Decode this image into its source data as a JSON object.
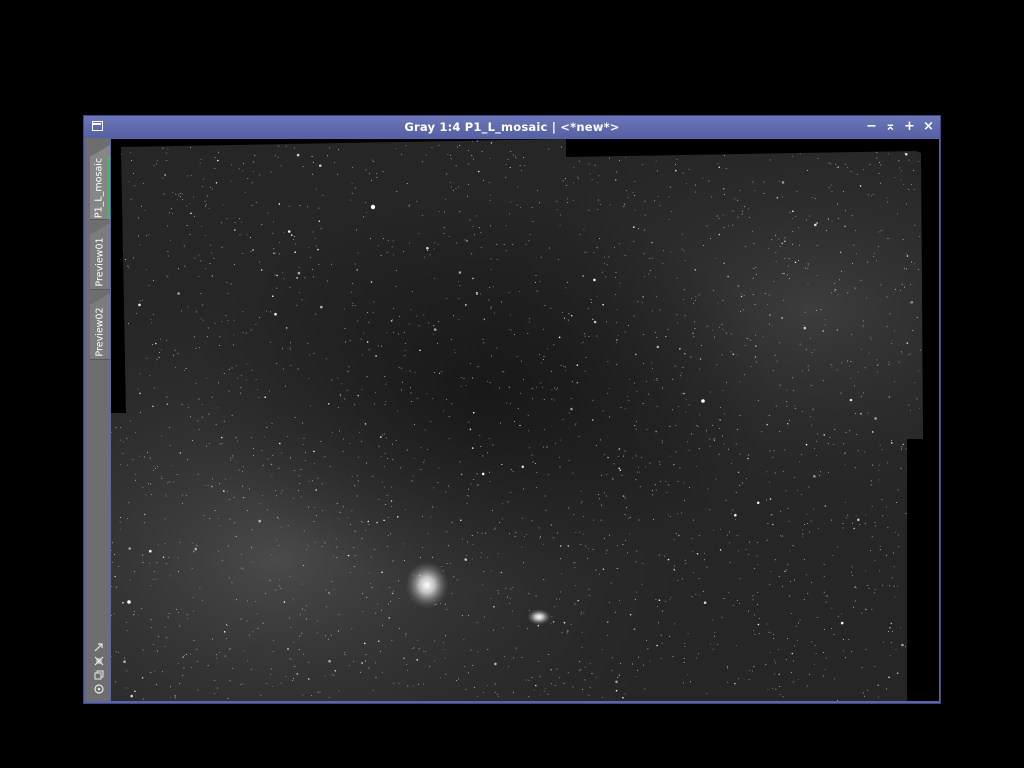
{
  "window": {
    "title": "Gray 1:4 P1_L_mosaic | <*new*>",
    "menu_icon": "window-menu-icon",
    "controls": {
      "minimize": "−",
      "shade": "⌅",
      "maximize": "+",
      "close": "×"
    }
  },
  "views": {
    "tabs": [
      {
        "label": "P1_L_mosaic",
        "active": true
      },
      {
        "label": "Preview01",
        "active": false
      },
      {
        "label": "Preview02",
        "active": false
      }
    ],
    "tools": [
      "zoom-to-fit-icon",
      "screen-transfer-icon",
      "copy-icon",
      "display-mode-icon"
    ]
  },
  "colors": {
    "title_bar": "#5a64a8",
    "side_strip": "#6e6e6e",
    "active_tab_indicator": "#3cbf5c",
    "sky_background": "#262626"
  }
}
